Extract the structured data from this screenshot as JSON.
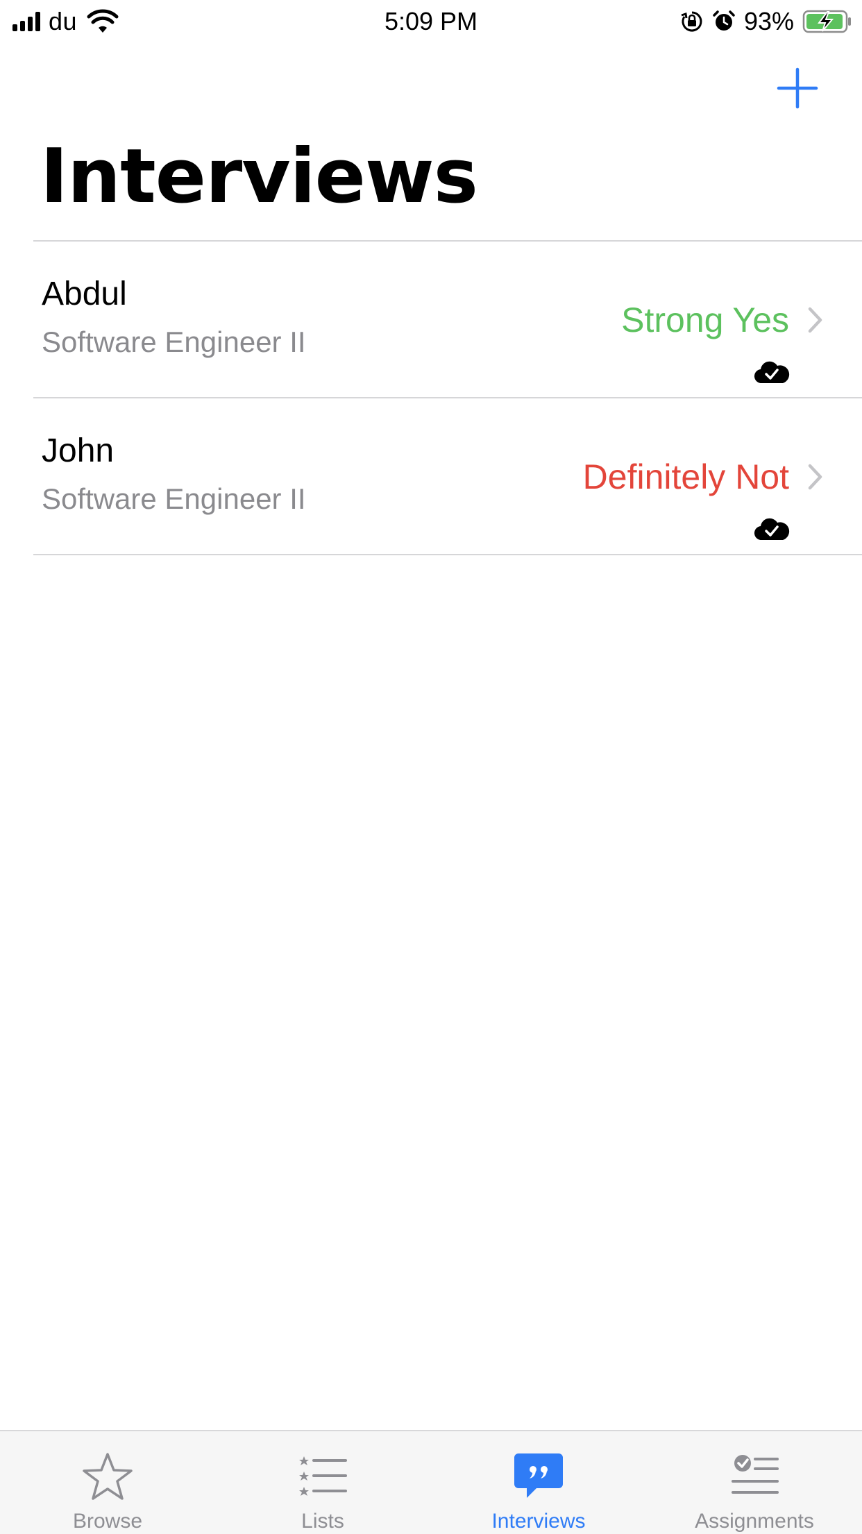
{
  "status_bar": {
    "carrier": "du",
    "time": "5:09 PM",
    "battery_percent": "93%",
    "icons": [
      "signal-icon",
      "wifi-icon",
      "orientation-lock-icon",
      "alarm-icon",
      "battery-charging-icon"
    ]
  },
  "nav": {
    "add_icon": "plus-icon",
    "title": "Interviews"
  },
  "colors": {
    "accent": "#2f7cf6",
    "positive": "#5cc15e",
    "negative": "#e3453a",
    "secondary_text": "#8a8a8e"
  },
  "interviews": [
    {
      "name": "Abdul",
      "role": "Software Engineer II",
      "verdict": "Strong Yes",
      "verdict_color": "#5cc15e",
      "sync_icon": "cloud-check-icon"
    },
    {
      "name": "John",
      "role": "Software Engineer II",
      "verdict": "Definitely Not",
      "verdict_color": "#e3453a",
      "sync_icon": "cloud-check-icon"
    }
  ],
  "tab_bar": {
    "tabs": [
      {
        "label": "Browse",
        "icon": "star-icon",
        "active": false
      },
      {
        "label": "Lists",
        "icon": "list-icon",
        "active": false
      },
      {
        "label": "Interviews",
        "icon": "quote-bubble-icon",
        "active": true
      },
      {
        "label": "Assignments",
        "icon": "checklist-icon",
        "active": false
      }
    ]
  }
}
